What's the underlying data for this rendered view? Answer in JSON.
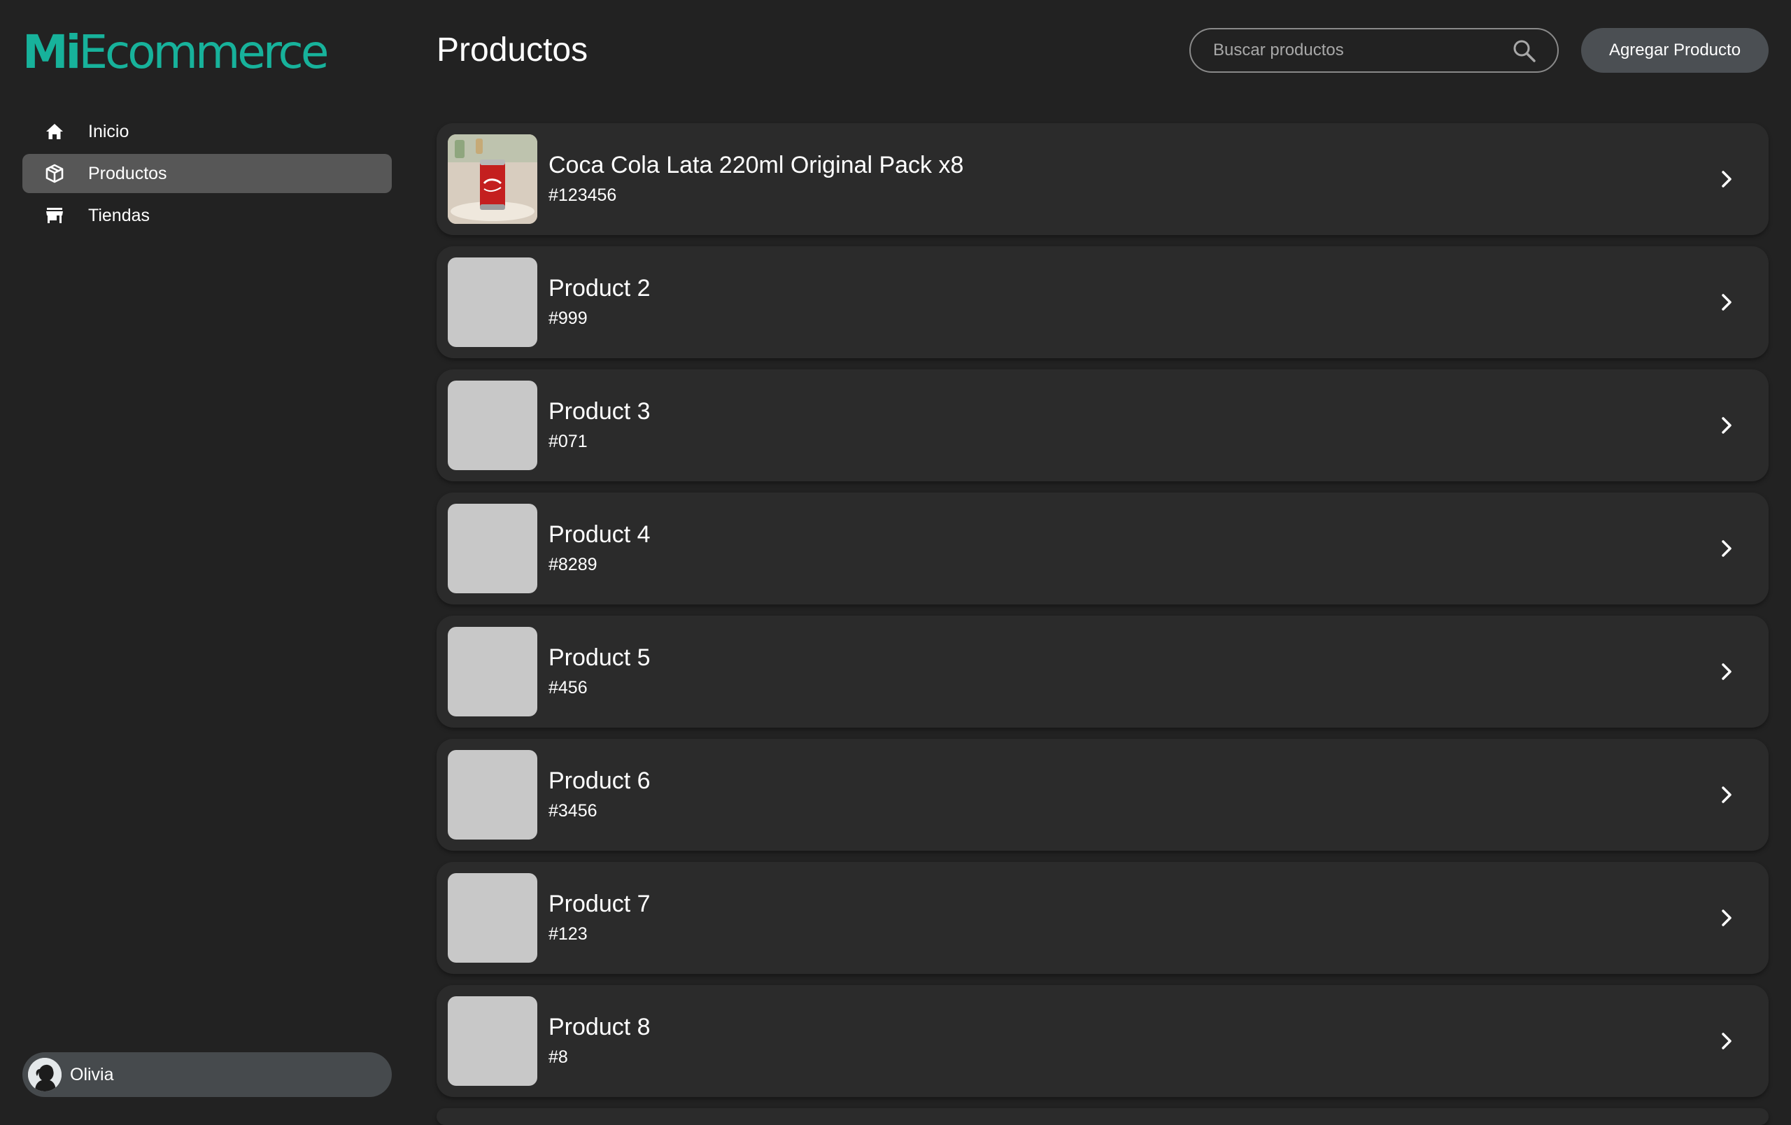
{
  "brand": {
    "logo_bold": "Mi",
    "logo_light": "Ecommerce",
    "color": "#17b29b"
  },
  "sidebar": {
    "items": [
      {
        "label": "Inicio",
        "icon": "home-icon",
        "active": false
      },
      {
        "label": "Productos",
        "icon": "box-icon",
        "active": true
      },
      {
        "label": "Tiendas",
        "icon": "store-icon",
        "active": false
      }
    ]
  },
  "user": {
    "name": "Olivia",
    "avatar_icon": "avatar-silhouette"
  },
  "header": {
    "title": "Productos",
    "search_placeholder": "Buscar productos",
    "add_button": "Agregar Producto"
  },
  "products": [
    {
      "name": "Coca Cola Lata 220ml Original Pack x8",
      "id": "#123456",
      "has_image": true
    },
    {
      "name": "Product 2",
      "id": "#999",
      "has_image": false
    },
    {
      "name": "Product 3",
      "id": "#071",
      "has_image": false
    },
    {
      "name": "Product 4",
      "id": "#8289",
      "has_image": false
    },
    {
      "name": "Product 5",
      "id": "#456",
      "has_image": false
    },
    {
      "name": "Product 6",
      "id": "#3456",
      "has_image": false
    },
    {
      "name": "Product 7",
      "id": "#123",
      "has_image": false
    },
    {
      "name": "Product 8",
      "id": "#8",
      "has_image": false
    }
  ],
  "colors": {
    "background": "#222222",
    "card": "#2b2b2b",
    "active_nav": "#575757",
    "placeholder_thumb": "#c8c8c8",
    "button": "#4b4f53"
  }
}
